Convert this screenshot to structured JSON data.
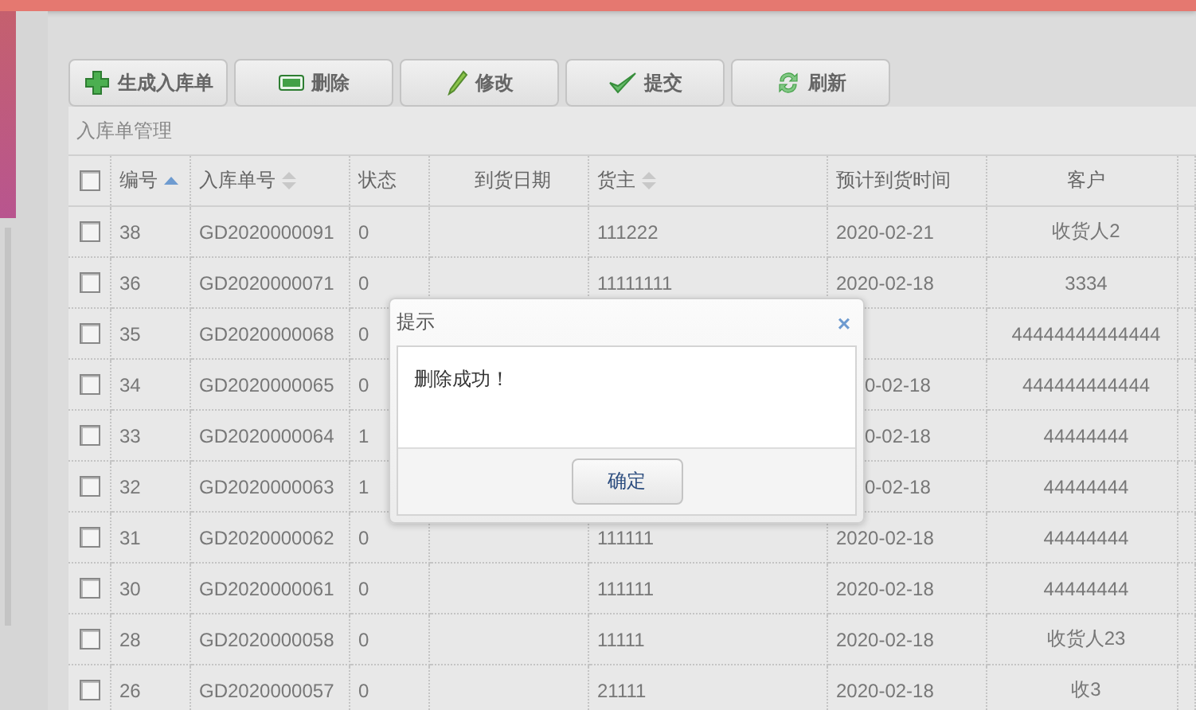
{
  "toolbar": [
    {
      "label": "生成入库单",
      "kind": "plus"
    },
    {
      "label": "删除",
      "kind": "minus"
    },
    {
      "label": "修改",
      "kind": "pencil"
    },
    {
      "label": "提交",
      "kind": "check"
    },
    {
      "label": "刷新",
      "kind": "refresh"
    }
  ],
  "panel": {
    "title": "入库单管理"
  },
  "table": {
    "select_all_checked": false,
    "columns": [
      {
        "label": "编号",
        "kind": "sorted"
      },
      {
        "label": "入库单号",
        "kind": "sortable"
      },
      {
        "label": "状态"
      },
      {
        "label": "到货日期"
      },
      {
        "label": "货主",
        "kind": "sortable"
      },
      {
        "label": "预计到货时间"
      },
      {
        "label": "客户"
      }
    ],
    "rows": [
      {
        "checked": false,
        "cells": [
          "38",
          "GD2020000091",
          "0",
          "",
          "111222",
          "2020-02-21",
          "收货人2"
        ]
      },
      {
        "checked": false,
        "cells": [
          "36",
          "GD2020000071",
          "0",
          "",
          "11111111",
          "2020-02-18",
          "3334"
        ]
      },
      {
        "checked": false,
        "cells": [
          "35",
          "GD2020000068",
          "0",
          "",
          "",
          "",
          "44444444444444"
        ]
      },
      {
        "checked": false,
        "under_dialog": true,
        "cells": [
          "34",
          "GD2020000065",
          "0",
          "",
          "",
          "0-02-18",
          "444444444444"
        ]
      },
      {
        "checked": false,
        "under_dialog": true,
        "cells": [
          "33",
          "GD2020000064",
          "1",
          "",
          "",
          "0-02-18",
          "44444444"
        ]
      },
      {
        "checked": false,
        "under_dialog": true,
        "cells": [
          "32",
          "GD2020000063",
          "1",
          "",
          "",
          "0-02-18",
          "44444444"
        ]
      },
      {
        "checked": false,
        "cells": [
          "31",
          "GD2020000062",
          "0",
          "",
          "111111",
          "2020-02-18",
          "44444444"
        ]
      },
      {
        "checked": false,
        "cells": [
          "30",
          "GD2020000061",
          "0",
          "",
          "111111",
          "2020-02-18",
          "44444444"
        ]
      },
      {
        "checked": false,
        "cells": [
          "28",
          "GD2020000058",
          "0",
          "",
          "11111",
          "2020-02-18",
          "收货人23"
        ]
      },
      {
        "checked": false,
        "cells": [
          "26",
          "GD2020000057",
          "0",
          "",
          "21111",
          "2020-02-18",
          "收3"
        ]
      }
    ]
  },
  "dialog": {
    "title": "提示",
    "close": "×",
    "message": "删除成功！",
    "button": "确定"
  }
}
